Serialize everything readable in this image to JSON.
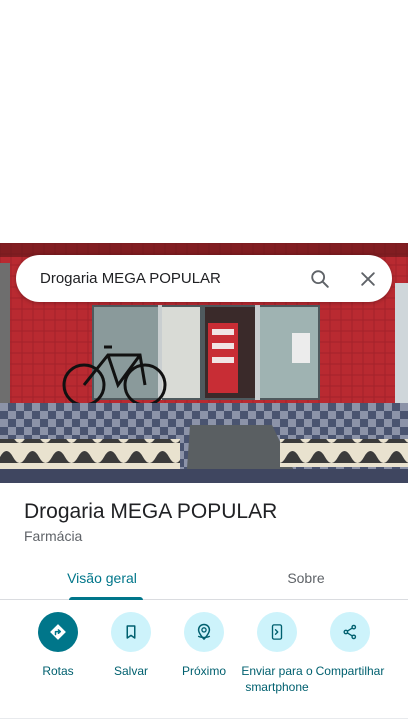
{
  "search": {
    "query": "Drogaria MEGA POPULAR"
  },
  "place": {
    "name": "Drogaria MEGA POPULAR",
    "category": "Farmácia"
  },
  "tabs": [
    {
      "label": "Visão geral",
      "active": true
    },
    {
      "label": "Sobre",
      "active": false
    }
  ],
  "actions": [
    {
      "label": "Rotas",
      "icon": "directions-icon"
    },
    {
      "label": "Salvar",
      "icon": "bookmark-icon"
    },
    {
      "label": "Próximo",
      "icon": "nearby-icon"
    },
    {
      "label": "Enviar para o smartphone",
      "icon": "send-to-phone-icon"
    },
    {
      "label": "Compartilhar",
      "icon": "share-icon"
    }
  ],
  "colors": {
    "accent": "#00768a",
    "accent_light": "#cdf3fb",
    "storefront_red": "#b0212a"
  }
}
